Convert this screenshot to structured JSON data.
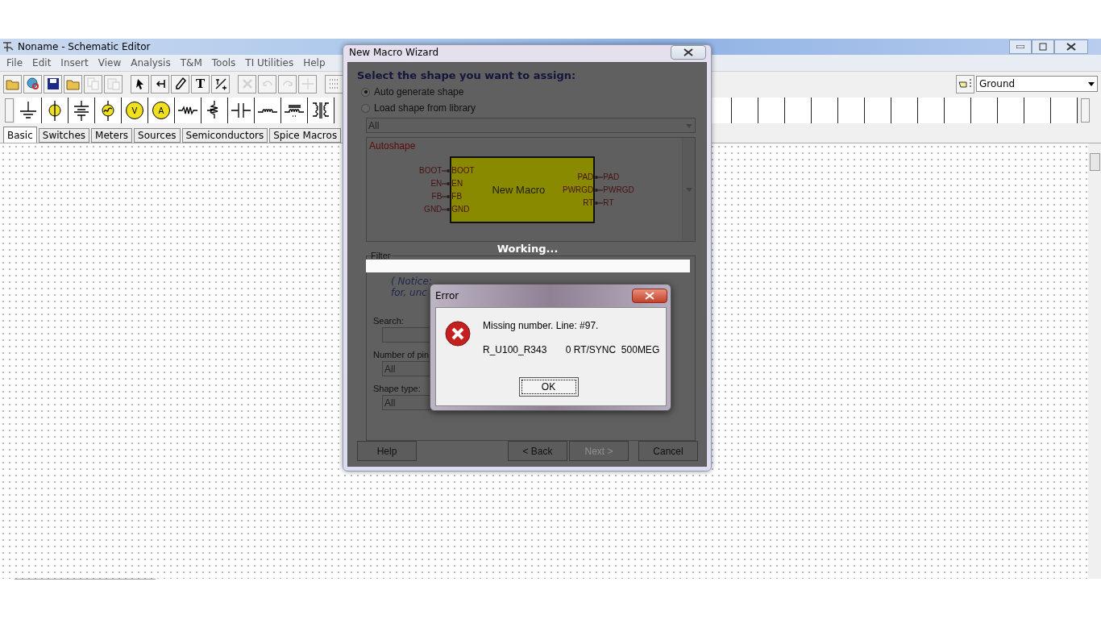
{
  "app": {
    "title": "Noname - Schematic Editor"
  },
  "menu": [
    "File",
    "Edit",
    "Insert",
    "View",
    "Analysis",
    "T&M",
    "Tools",
    "TI Utilities",
    "Help"
  ],
  "toolbar": [
    {
      "kind": "open",
      "disabled": false
    },
    {
      "kind": "web",
      "disabled": false
    },
    {
      "kind": "save",
      "disabled": false
    },
    {
      "kind": "open",
      "disabled": false
    },
    {
      "kind": "copy",
      "disabled": true
    },
    {
      "kind": "paste",
      "disabled": true
    },
    {
      "kind": "select",
      "disabled": false
    },
    {
      "kind": "wire",
      "disabled": false
    },
    {
      "kind": "pen",
      "disabled": false
    },
    {
      "kind": "text",
      "label": "T",
      "disabled": false
    },
    {
      "kind": "label",
      "disabled": false
    },
    {
      "kind": "delete",
      "disabled": true
    },
    {
      "kind": "undo",
      "disabled": true
    },
    {
      "kind": "redo",
      "disabled": true
    },
    {
      "kind": "junction",
      "disabled": true
    },
    {
      "kind": "grid",
      "disabled": false
    }
  ],
  "component_select": {
    "value": "Ground"
  },
  "palette": [
    {
      "kind": "ground"
    },
    {
      "kind": "dc_source"
    },
    {
      "kind": "battery"
    },
    {
      "kind": "ac_source"
    },
    {
      "kind": "meter",
      "label": "V"
    },
    {
      "kind": "meter",
      "label": "A"
    },
    {
      "kind": "resistor"
    },
    {
      "kind": "potentiometer"
    },
    {
      "kind": "capacitor"
    },
    {
      "kind": "inductor"
    },
    {
      "kind": "core_inductor"
    },
    {
      "kind": "transformer"
    }
  ],
  "palette_tabs": [
    {
      "label": "Basic",
      "selected": true
    },
    {
      "label": "Switches",
      "selected": false
    },
    {
      "label": "Meters",
      "selected": false
    },
    {
      "label": "Sources",
      "selected": false
    },
    {
      "label": "Semiconductors",
      "selected": false
    },
    {
      "label": "Spice Macros",
      "selected": false
    }
  ],
  "wizard": {
    "title": "New Macro Wizard",
    "heading": "Select the shape you want to assign:",
    "options": [
      {
        "label": "Auto generate shape",
        "selected": true
      },
      {
        "label": "Load shape from library",
        "selected": false
      }
    ],
    "library_select": {
      "value": "All"
    },
    "preview": {
      "title": "Autoshape",
      "macro_name": "New Macro",
      "outer_left_pins": [
        "BOOT",
        "EN",
        "FB",
        "GND"
      ],
      "inner_left_pins": [
        "BOOT",
        "EN",
        "FB",
        "GND"
      ],
      "inner_right_pins": [
        "PAD",
        "PWRGD",
        "RT"
      ],
      "outer_right_pins": [
        "PAD",
        "PWRGD",
        "RT"
      ]
    },
    "status": "Working...",
    "progress": {
      "level": 1
    },
    "filter": {
      "title": "Filter",
      "notice_lines": [
        "( Notice:",
        "for, unc"
      ],
      "search_label": "Search:",
      "pins_label": "Number of pin",
      "pins_value": "All",
      "type_label": "Shape type:",
      "type_value": "All"
    },
    "buttons": [
      {
        "label": "Help",
        "disabled": false
      },
      {
        "label": "< Back",
        "disabled": false
      },
      {
        "label": "Next >",
        "disabled": true
      },
      {
        "label": "Cancel",
        "disabled": false
      }
    ]
  },
  "error": {
    "title": "Error",
    "message": "Missing number. Line: #97.",
    "detail": "R_U100_R343       0 RT/SYNC  500MEG",
    "button": "OK"
  }
}
